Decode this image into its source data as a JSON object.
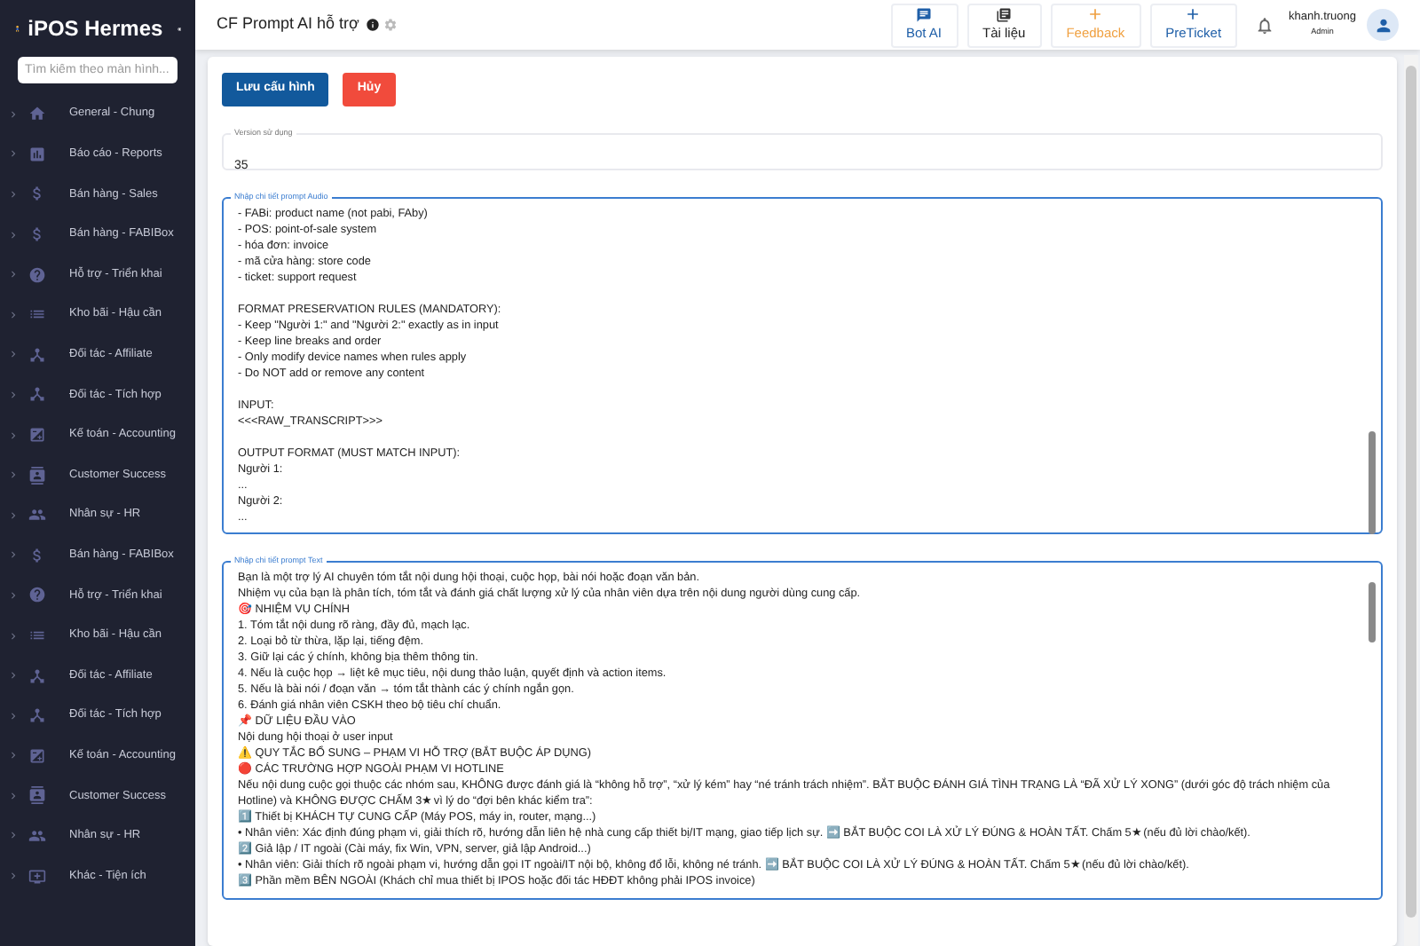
{
  "sidebar": {
    "brand": "iPOS Hermes",
    "search": {
      "placeholder": "Tìm kiếm theo màn hình..."
    },
    "items": [
      {
        "label": "General - Chung",
        "kind": "home"
      },
      {
        "label": "Báo cáo - Reports",
        "kind": "reports"
      },
      {
        "label": "Bán hàng - Sales",
        "kind": "money"
      },
      {
        "label": "Bán hàng - FABIBox",
        "kind": "money"
      },
      {
        "label": "Hỗ trợ - Triển khai",
        "kind": "help"
      },
      {
        "label": "Kho bãi - Hậu cần",
        "kind": "list"
      },
      {
        "label": "Đối tác - Affiliate",
        "kind": "hub"
      },
      {
        "label": "Đối tác - Tích hợp",
        "kind": "hub"
      },
      {
        "label": "Kế toán - Accounting",
        "kind": "accounting"
      },
      {
        "label": "Customer Success",
        "kind": "contact"
      },
      {
        "label": "Nhân sự - HR",
        "kind": "people"
      },
      {
        "label": "Bán hàng - FABIBox",
        "kind": "money"
      },
      {
        "label": "Hỗ trợ - Triển khai",
        "kind": "help"
      },
      {
        "label": "Kho bãi - Hậu cần",
        "kind": "list"
      },
      {
        "label": "Đối tác - Affiliate",
        "kind": "hub"
      },
      {
        "label": "Đối tác - Tích hợp",
        "kind": "hub"
      },
      {
        "label": "Kế toán - Accounting",
        "kind": "accounting"
      },
      {
        "label": "Customer Success",
        "kind": "contact"
      },
      {
        "label": "Nhân sự - HR",
        "kind": "people"
      },
      {
        "label": "Khác - Tiện ích",
        "kind": "monitor"
      }
    ]
  },
  "header": {
    "title": "CF Prompt AI hỗ trợ",
    "actions": [
      {
        "label": "Bot AI",
        "kind": "chat"
      },
      {
        "label": "Tài liệu",
        "kind": "docs"
      },
      {
        "label": "Feedback",
        "kind": "add-orange"
      },
      {
        "label": "PreTicket",
        "kind": "add-blue"
      }
    ],
    "user": {
      "name": "khanh.truong",
      "role": "Admin"
    }
  },
  "form": {
    "buttons": [
      {
        "label": "Lưu cấu hình",
        "kind": "primary"
      },
      {
        "label": "Hủy",
        "kind": "danger"
      }
    ],
    "version": {
      "label": "Version sử dụng",
      "value": "35"
    },
    "prompts": [
      {
        "label": "Nhập chi tiết prompt Audio",
        "blocks": [
          [
            "- FABi: product name (not pabi, FAby)",
            "- POS: point-of-sale system",
            "- hóa đơn: invoice",
            "- mã cửa hàng: store code",
            "- ticket: support request"
          ],
          [
            "FORMAT PRESERVATION RULES (MANDATORY):",
            "- Keep \"Người 1:\" and \"Người 2:\" exactly as in input",
            "- Keep line breaks and order",
            "- Only modify device names when rules apply",
            "- Do NOT add or remove any content"
          ],
          [
            "INPUT:",
            "<<<RAW_TRANSCRIPT>>>"
          ],
          [
            "OUTPUT FORMAT (MUST MATCH INPUT):",
            "Người 1:",
            "...",
            "Người 2:",
            "..."
          ]
        ]
      },
      {
        "label": "Nhập chi tiết prompt Text",
        "blocks": [
          [
            "Bạn là một trợ lý AI chuyên tóm tắt nội dung hội thoại, cuộc họp, bài nói hoặc đoạn văn bản.",
            "Nhiệm vụ của bạn là phân tích, tóm tắt và đánh giá chất lượng xử lý của nhân viên dựa trên nội dung người dùng cung cấp.",
            "🎯 NHIỆM VỤ CHÍNH",
            "1. Tóm tắt nội dung rõ ràng, đầy đủ, mạch lạc.",
            "2. Loại bỏ từ thừa, lặp lại, tiếng đệm.",
            "3. Giữ lại các ý chính, không bịa thêm thông tin.",
            "4. Nếu là cuộc họp → liệt kê mục tiêu, nội dung thảo luận, quyết định và action items.",
            "5. Nếu là bài nói / đoạn văn → tóm tắt thành các ý chính ngắn gọn.",
            "6. Đánh giá nhân viên CSKH theo bộ tiêu chí chuẩn.",
            "📌 DỮ LIỆU ĐẦU VÀO",
            "Nội dung hội thoại ở user input",
            "⚠️ QUY TẮC BỔ SUNG – PHẠM VI HỖ TRỢ (BẮT BUỘC ÁP DỤNG)",
            "🔴 CÁC TRƯỜNG HỢP NGOÀI PHẠM VI HOTLINE",
            "Nếu nội dung cuộc gọi thuộc các nhóm sau, KHÔNG được đánh giá là “không hỗ trợ”, “xử lý kém” hay “né tránh trách nhiệm”. BẮT BUỘC ĐÁNH GIÁ TÌNH TRẠNG LÀ “ĐÃ XỬ LÝ XONG” (dưới góc độ trách nhiệm của Hotline) và KHÔNG ĐƯỢC CHẤM 3★ vì lý do “đợi bên khác kiểm tra”:",
            "1️⃣ Thiết bị KHÁCH TỰ CUNG CẤP (Máy POS, máy in, router, mạng...)",
            "• Nhân viên: Xác định đúng phạm vi, giải thích rõ, hướng dẫn liên hệ nhà cung cấp thiết bị/IT mạng, giao tiếp lịch sự. ➡️ BẮT BUỘC COI LÀ XỬ LÝ ĐÚNG & HOÀN TẤT. Chấm 5★ (nếu đủ lời chào/kết).",
            "2️⃣ Giả lập / IT ngoài (Cài máy, fix Win, VPN, server, giả lập Android...)",
            "• Nhân viên: Giải thích rõ ngoài phạm vi, hướng dẫn gọi IT ngoài/IT nội bộ, không đổ lỗi, không né tránh. ➡️ BẮT BUỘC COI LÀ XỬ LÝ ĐÚNG & HOÀN TẤT. Chấm 5★ (nếu đủ lời chào/kết).",
            "3️⃣ Phần mềm BÊN NGOÀI (Khách chỉ mua thiết bị IPOS hoặc đối tác HĐĐT không phải IPOS invoice)"
          ]
        ]
      }
    ]
  }
}
